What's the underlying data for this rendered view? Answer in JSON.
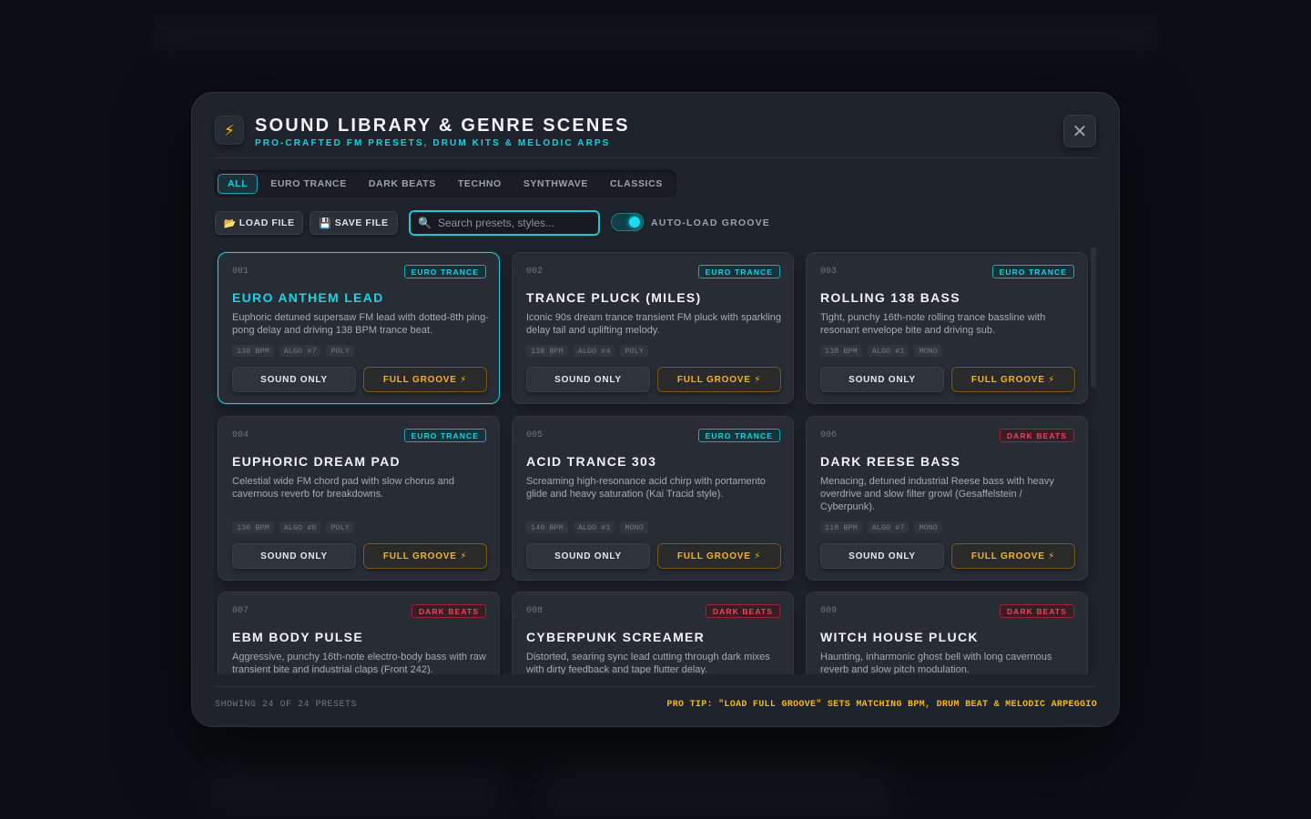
{
  "modal": {
    "logo_icon": "⚡",
    "title": "SOUND LIBRARY & GENRE SCENES",
    "subtitle": "PRO-CRAFTED FM PRESETS, DRUM KITS & MELODIC ARPS",
    "close_icon": "✕"
  },
  "tabs": [
    {
      "label": "ALL",
      "active": true
    },
    {
      "label": "EURO TRANCE",
      "active": false
    },
    {
      "label": "DARK BEATS",
      "active": false
    },
    {
      "label": "TECHNO",
      "active": false
    },
    {
      "label": "SYNTHWAVE",
      "active": false
    },
    {
      "label": "CLASSICS",
      "active": false
    }
  ],
  "toolbar": {
    "load_icon": "📂",
    "load_label": "LOAD FILE",
    "save_icon": "💾",
    "save_label": "SAVE FILE",
    "search_icon": "🔍",
    "search_placeholder": "Search presets, styles...",
    "search_value": "",
    "autoload_label": "AUTO-LOAD GROOVE",
    "autoload_on": true
  },
  "card_buttons": {
    "sound_only": "SOUND ONLY",
    "full_groove": "FULL GROOVE ⚡"
  },
  "presets": [
    {
      "num": "001",
      "badge": "EURO TRANCE",
      "genre": "trance",
      "title": "EURO ANTHEM LEAD",
      "desc": "Euphoric detuned supersaw FM lead with dotted-8th ping-pong delay and driving 138 BPM trance beat.",
      "tags": [
        "138 BPM",
        "ALGO #7",
        "POLY"
      ],
      "selected": true
    },
    {
      "num": "002",
      "badge": "EURO TRANCE",
      "genre": "trance",
      "title": "TRANCE PLUCK (MILES)",
      "desc": "Iconic 90s dream trance transient FM pluck with sparkling delay tail and uplifting melody.",
      "tags": [
        "138 BPM",
        "ALGO #4",
        "POLY"
      ],
      "selected": false
    },
    {
      "num": "003",
      "badge": "EURO TRANCE",
      "genre": "trance",
      "title": "ROLLING 138 BASS",
      "desc": "Tight, punchy 16th-note rolling trance bassline with resonant envelope bite and driving sub.",
      "tags": [
        "138 BPM",
        "ALGO #1",
        "MONO"
      ],
      "selected": false
    },
    {
      "num": "004",
      "badge": "EURO TRANCE",
      "genre": "trance",
      "title": "EUPHORIC DREAM PAD",
      "desc": "Celestial wide FM chord pad with slow chorus and cavernous reverb for breakdowns.",
      "tags": [
        "136 BPM",
        "ALGO #8",
        "POLY"
      ],
      "selected": false
    },
    {
      "num": "005",
      "badge": "EURO TRANCE",
      "genre": "trance",
      "title": "ACID TRANCE 303",
      "desc": "Screaming high-resonance acid chirp with portamento glide and heavy saturation (Kai Tracid style).",
      "tags": [
        "140 BPM",
        "ALGO #1",
        "MONO"
      ],
      "selected": false
    },
    {
      "num": "006",
      "badge": "DARK BEATS",
      "genre": "dark",
      "title": "DARK REESE BASS",
      "desc": "Menacing, detuned industrial Reese bass with heavy overdrive and slow filter growl (Gesaffelstein / Cyberpunk).",
      "tags": [
        "118 BPM",
        "ALGO #7",
        "MONO"
      ],
      "selected": false
    },
    {
      "num": "007",
      "badge": "DARK BEATS",
      "genre": "dark",
      "title": "EBM BODY PULSE",
      "desc": "Aggressive, punchy 16th-note electro-body bass with raw transient bite and industrial claps (Front 242).",
      "tags": [],
      "selected": false
    },
    {
      "num": "008",
      "badge": "DARK BEATS",
      "genre": "dark",
      "title": "CYBERPUNK SCREAMER",
      "desc": "Distorted, searing sync lead cutting through dark mixes with dirty feedback and tape flutter delay.",
      "tags": [],
      "selected": false
    },
    {
      "num": "009",
      "badge": "DARK BEATS",
      "genre": "dark",
      "title": "WITCH HOUSE PLUCK",
      "desc": "Haunting, inharmonic ghost bell with long cavernous reverb and slow pitch modulation.",
      "tags": [],
      "selected": false
    }
  ],
  "footer": {
    "count_text": "SHOWING 24 OF 24 PRESETS",
    "tip_text": "PRO TIP: \"LOAD FULL GROOVE\" SETS MATCHING BPM, DRUM BEAT & MELODIC ARPEGGIO"
  }
}
